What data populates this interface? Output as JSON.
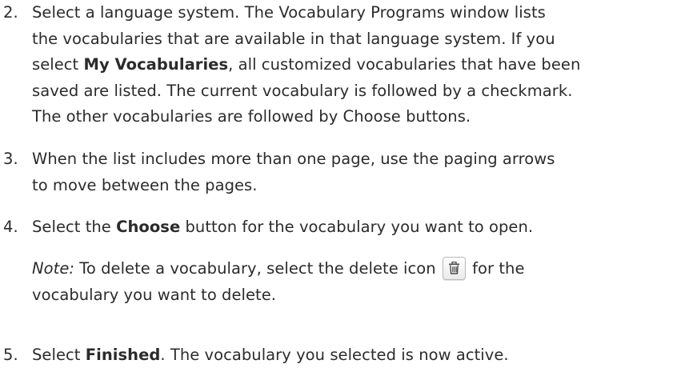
{
  "steps": [
    {
      "number": "2.",
      "lines": [
        {
          "pre": "Select a language system. The Vocabulary Programs window lists"
        },
        {
          "pre": "the vocabularies that are available in that language system. If you"
        },
        {
          "pre": "select ",
          "bold": "My Vocabularies",
          "post": ", all customized vocabularies that have been"
        },
        {
          "pre": "saved are listed. The current vocabulary is followed by a checkmark."
        },
        {
          "pre": "The other vocabularies are followed by Choose buttons."
        }
      ]
    },
    {
      "number": "3.",
      "lines": [
        {
          "pre": "When the list includes more than one page, use the paging arrows"
        },
        {
          "pre": "to move between the pages."
        }
      ]
    },
    {
      "number": "4.",
      "lines": [
        {
          "pre": "Select the ",
          "bold": "Choose",
          "post": " button for the vocabulary you want to open."
        }
      ],
      "note": {
        "label": "Note:",
        "line1_pre": " To delete a vocabulary, select the delete icon ",
        "icon": "trash-icon",
        "line1_post": " for the",
        "line2": "vocabulary you want to delete."
      }
    },
    {
      "number": "5.",
      "lines": [
        {
          "pre": "Select ",
          "bold": "Finished",
          "post": ". The vocabulary you selected is now active."
        }
      ]
    }
  ]
}
